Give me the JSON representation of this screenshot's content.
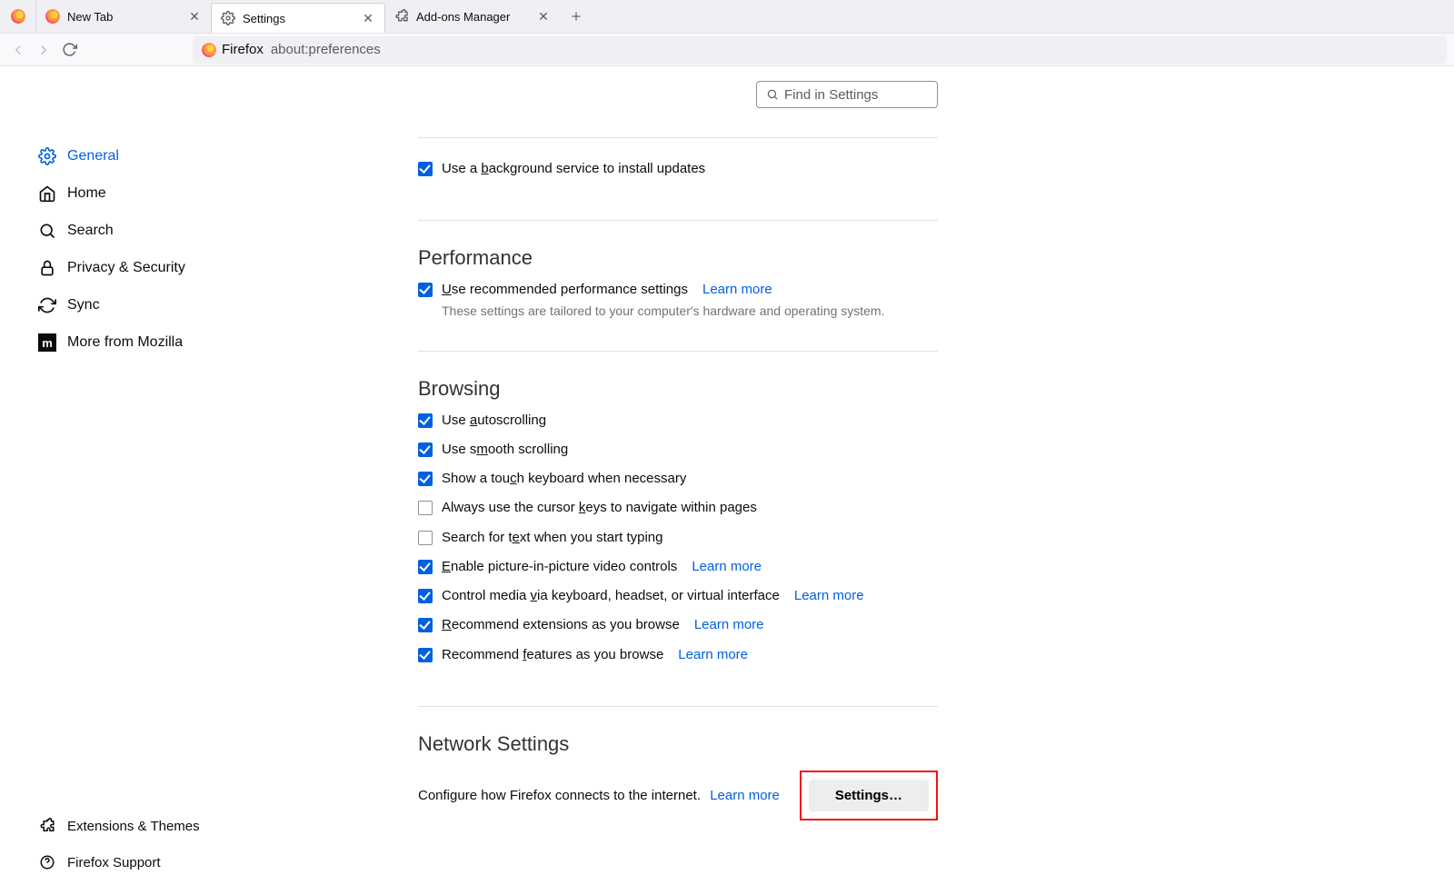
{
  "tabs": {
    "items": [
      {
        "title": "New Tab"
      },
      {
        "title": "Settings"
      },
      {
        "title": "Add-ons Manager"
      }
    ]
  },
  "urlbar": {
    "identity": "Firefox",
    "url": "about:preferences"
  },
  "sidebar": {
    "items": [
      {
        "label": "General"
      },
      {
        "label": "Home"
      },
      {
        "label": "Search"
      },
      {
        "label": "Privacy & Security"
      },
      {
        "label": "Sync"
      },
      {
        "label": "More from Mozilla"
      }
    ],
    "footer": [
      {
        "label": "Extensions & Themes"
      },
      {
        "label": "Firefox Support"
      }
    ]
  },
  "search": {
    "placeholder": "Find in Settings"
  },
  "updates": {
    "bg_service": "Use a background service to install updates"
  },
  "performance": {
    "title": "Performance",
    "recommended": "Use recommended performance settings",
    "learn_more": "Learn more",
    "subtext": "These settings are tailored to your computer's hardware and operating system."
  },
  "browsing": {
    "title": "Browsing",
    "autoscroll": "Use autoscrolling",
    "smooth": "Use smooth scrolling",
    "touchkb": "Show a touch keyboard when necessary",
    "cursor_keys": "Always use the cursor keys to navigate within pages",
    "search_typing": "Search for text when you start typing",
    "pip": "Enable picture-in-picture video controls",
    "media_keys": "Control media via keyboard, headset, or virtual interface",
    "rec_ext": "Recommend extensions as you browse",
    "rec_feat": "Recommend features as you browse",
    "learn_more": "Learn more"
  },
  "network": {
    "title": "Network Settings",
    "desc": "Configure how Firefox connects to the internet.",
    "learn_more": "Learn more",
    "button": "Settings…"
  }
}
